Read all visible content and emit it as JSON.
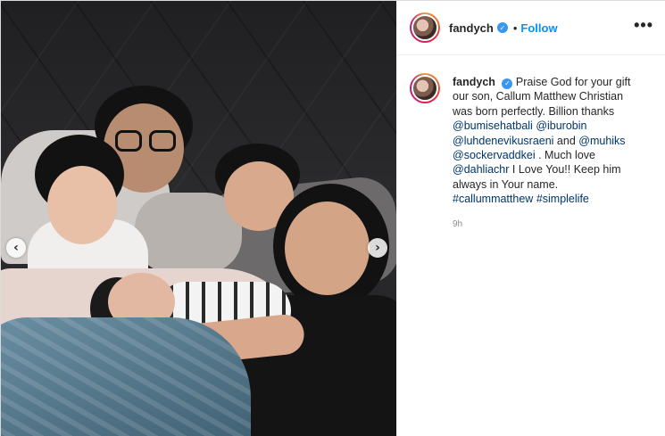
{
  "post": {
    "username": "fandych",
    "follow_label": "Follow",
    "separator": "•",
    "more_label": "•••",
    "verified_mark": "✓"
  },
  "caption": {
    "username": "fandych",
    "text_1": "Praise God for your gift our son, Callum Matthew Christian was born perfectly. Billion thanks ",
    "mention_1": "@bumisehatbali",
    "mention_2": "@iburobin",
    "mention_3": "@luhdenevikusraeni",
    "text_2": " and ",
    "mention_4": "@muhiks",
    "mention_5": "@sockervaddkei",
    "text_3": " . Much love ",
    "mention_6": "@dahliachr",
    "text_4": " I Love You!! Keep him always in Your name. ",
    "hashtag_1": "#callummatthew",
    "hashtag_2": "#simplelife"
  },
  "timestamp": "9h",
  "nav": {
    "prev_glyph": "‹",
    "next_glyph": "›"
  },
  "icons": {
    "verified": "verified-badge-icon",
    "more": "more-options-icon",
    "prev": "chevron-left-icon",
    "next": "chevron-right-icon"
  },
  "colors": {
    "link": "#0095f6",
    "mention": "#003569",
    "verified": "#3897f0",
    "muted": "#8e8e8e"
  }
}
